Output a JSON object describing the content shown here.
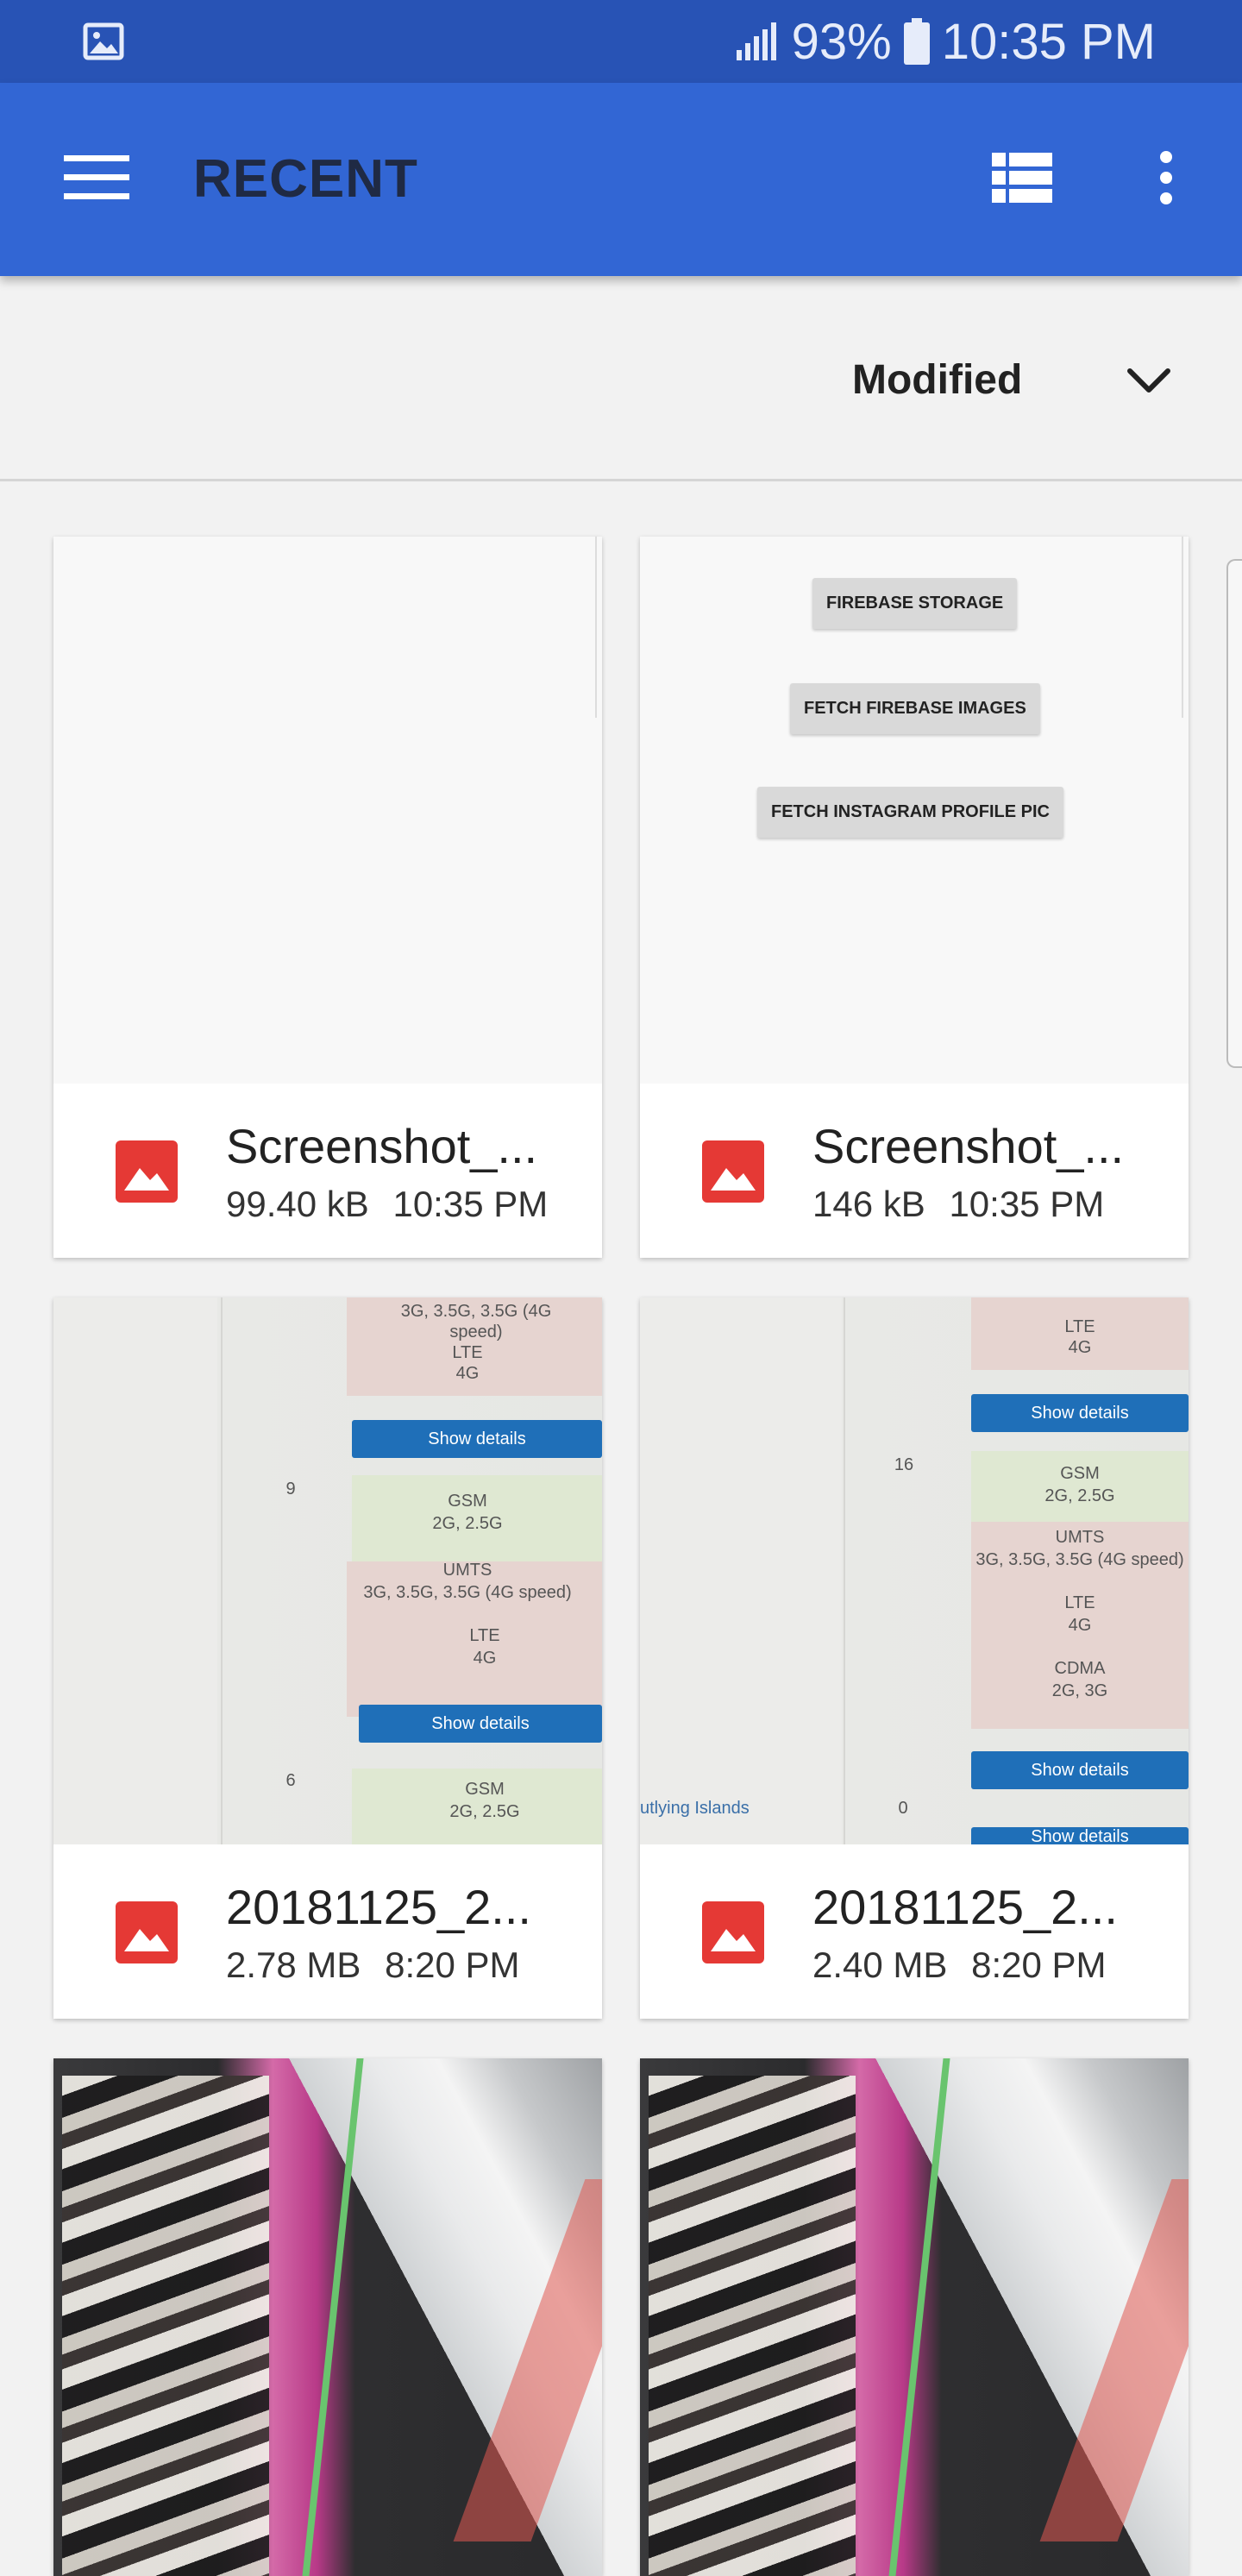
{
  "status_bar": {
    "battery": "93%",
    "time": "10:35 PM",
    "icons": [
      "gallery-icon",
      "signal-icon",
      "battery-icon"
    ]
  },
  "app_bar": {
    "title": "RECENT",
    "icons": [
      "menu-icon",
      "list-view-icon",
      "more-vert-icon"
    ]
  },
  "sort": {
    "label": "Modified",
    "icon": "chevron-down-icon"
  },
  "files": [
    {
      "name": "Screenshot_...",
      "size": "99.40 kB",
      "time": "10:35 PM",
      "icon": "image-icon"
    },
    {
      "name": "Screenshot_...",
      "size": "146 kB",
      "time": "10:35 PM",
      "icon": "image-icon",
      "preview_buttons": [
        "FIREBASE STORAGE",
        "FETCH FIREBASE IMAGES",
        "FETCH INSTAGRAM PROFILE PIC"
      ]
    },
    {
      "name": "20181125_2...",
      "size": "2.78 MB",
      "time": "8:20 PM",
      "icon": "image-icon",
      "preview_text": {
        "row_a": "3G, 3.5G, 3.5G (4G speed)",
        "lte": "LTE",
        "g4": "4G",
        "show": "Show details",
        "n9": "9",
        "gsm": "GSM",
        "gsm_sub": "2G, 2.5G",
        "umts": "UMTS",
        "umts_sub": "3G, 3.5G, 3.5G (4G speed)",
        "lte2": "LTE",
        "g4b": "4G",
        "show2": "Show details",
        "n6": "6",
        "gsm2": "GSM",
        "gsm2_sub": "2G, 2.5G"
      }
    },
    {
      "name": "20181125_2...",
      "size": "2.40 MB",
      "time": "8:20 PM",
      "icon": "image-icon",
      "preview_text": {
        "lte": "LTE",
        "g4": "4G",
        "show": "Show details",
        "n16": "16",
        "gsm": "GSM",
        "gsm_sub": "2G, 2.5G",
        "umts": "UMTS",
        "umts_sub": "3G, 3.5G, 3.5G (4G speed)",
        "lte2": "LTE",
        "g4b": "4G",
        "cdma": "CDMA",
        "cdma_sub": "2G, 3G",
        "show2": "Show details",
        "islands": "utlying Islands",
        "n0": "0",
        "show3": "Show details"
      }
    },
    {
      "name": "",
      "size": "",
      "time": "",
      "icon": "image-icon"
    },
    {
      "name": "",
      "size": "",
      "time": "",
      "icon": "image-icon"
    }
  ],
  "colors": {
    "status_bar": "#2853b5",
    "app_bar": "#3266d4",
    "file_icon": "#e53935",
    "background": "#f2f2f2"
  }
}
